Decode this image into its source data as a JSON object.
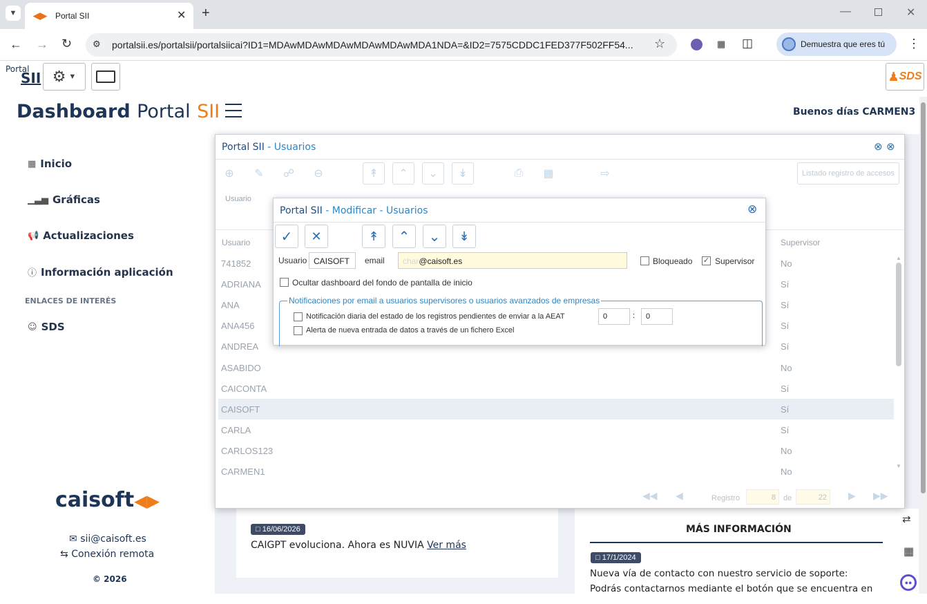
{
  "browser": {
    "tab_title": "Portal SII",
    "url": "portalsii.es/portalsii/portalsiicai?ID1=MDAwMDAwMDAwMDAwMDAwMDA1NDA=&ID2=7575CDDC1FED377F502FF54...",
    "profile_label": "Demuestra que eres tú"
  },
  "header": {
    "logo_top": "Portal",
    "logo_bottom": "SII",
    "title_dashboard": "Dashboard",
    "title_portal": "Portal",
    "title_sii": "SII",
    "greeting": "Buenos días CARMEN3",
    "sds_logo": "SDS"
  },
  "sidebar": {
    "items": [
      {
        "label": "Inicio"
      },
      {
        "label": "Gráficas"
      },
      {
        "label": "Actualizaciones"
      },
      {
        "label": "Información aplicación"
      }
    ],
    "links_heading": "ENLACES DE INTERÉS",
    "link_sds": "SDS",
    "brand": "caisoft",
    "email": "sii@caisoft.es",
    "remote": "Conexión remota",
    "copyright": "© 2026"
  },
  "users_window": {
    "title_prefix": "Portal SII",
    "title_suffix": "Usuarios",
    "separator": " - ",
    "access_button": "Listado registro de accesos",
    "filter_label": "Usuario",
    "col_user": "Usuario",
    "col_supervisor": "Supervisor",
    "rows": [
      {
        "user": "741852",
        "sup": "No"
      },
      {
        "user": "ADRIANA",
        "sup": "Sí"
      },
      {
        "user": "ANA",
        "sup": "Sí"
      },
      {
        "user": "ANA456",
        "sup": "Sí"
      },
      {
        "user": "ANDREA",
        "sup": "Sí"
      },
      {
        "user": "ASABIDO",
        "sup": "No"
      },
      {
        "user": "CAICONTA",
        "sup": "Sí"
      },
      {
        "user": "CAISOFT",
        "sup": "Sí"
      },
      {
        "user": "CARLA",
        "sup": "Sí"
      },
      {
        "user": "CARLOS123",
        "sup": "No"
      },
      {
        "user": "CARMEN1",
        "sup": "No"
      }
    ],
    "selected_index": 7,
    "registro_label": "Registro",
    "registro_value": "8",
    "de_label": "de",
    "total": "22"
  },
  "modify_window": {
    "title_prefix": "Portal SII",
    "title_middle": "Modificar",
    "title_suffix": "Usuarios",
    "user_label": "Usuario",
    "user_value": "CAISOFT",
    "email_label": "email",
    "email_placeholder": "char",
    "email_value": "@caisoft.es",
    "blocked_label": "Bloqueado",
    "supervisor_label": "Supervisor",
    "hide_dashboard_label": "Ocultar dashboard del fondo de pantalla de inicio",
    "fieldset_legend": "Notificaciones por email a usuarios supervisores o usuarios avanzados de empresas",
    "daily_notification_label": "Notificación diaria del estado de los registros pendientes de enviar a la AEAT",
    "hour_value": "0",
    "minute_value": "0",
    "excel_alert_label": "Alerta de nueva entrada de datos a través de un fichero Excel"
  },
  "news": {
    "date1": "16/06/2026",
    "text1": "CAIGPT evoluciona. Ahora es NUVIA",
    "link1": "Ver más",
    "more_info_title": "MÁS INFORMACIÓN",
    "date2": "17/1/2024",
    "text2_line1": "Nueva vía de contacto con nuestro servicio de soporte:",
    "text2_line2": "Podrás contactarnos mediante el botón que se encuentra en"
  },
  "colors": {
    "brand_navy": "#1d3557",
    "brand_orange": "#ef7d1a",
    "link_blue": "#2a87c9"
  }
}
